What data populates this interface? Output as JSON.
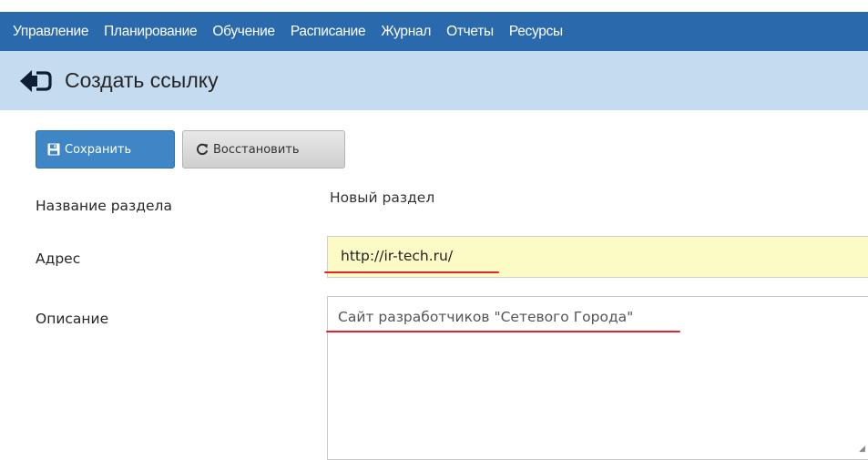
{
  "nav": {
    "items": [
      "Управление",
      "Планирование",
      "Обучение",
      "Расписание",
      "Журнал",
      "Отчеты",
      "Ресурсы"
    ]
  },
  "header": {
    "back_icon": "arrow-left-icon",
    "title": "Создать ссылку"
  },
  "toolbar": {
    "save_label": "Сохранить",
    "save_icon": "floppy-disk-icon",
    "restore_label": "Восстановить",
    "restore_icon": "refresh-icon"
  },
  "form": {
    "section_name": {
      "label": "Название раздела",
      "value": "Новый раздел"
    },
    "address": {
      "label": "Адрес",
      "value": "http://ir-tech.ru/"
    },
    "description": {
      "label": "Описание",
      "value": "Сайт разработчиков \"Сетевого Города\""
    }
  },
  "colors": {
    "nav_bg": "#2a6aac",
    "subheader_bg": "#c4dbf0",
    "save_button_bg": "#3e86c6",
    "address_field_bg": "#fdfbc5",
    "annotation_underline": "#e8232a"
  }
}
